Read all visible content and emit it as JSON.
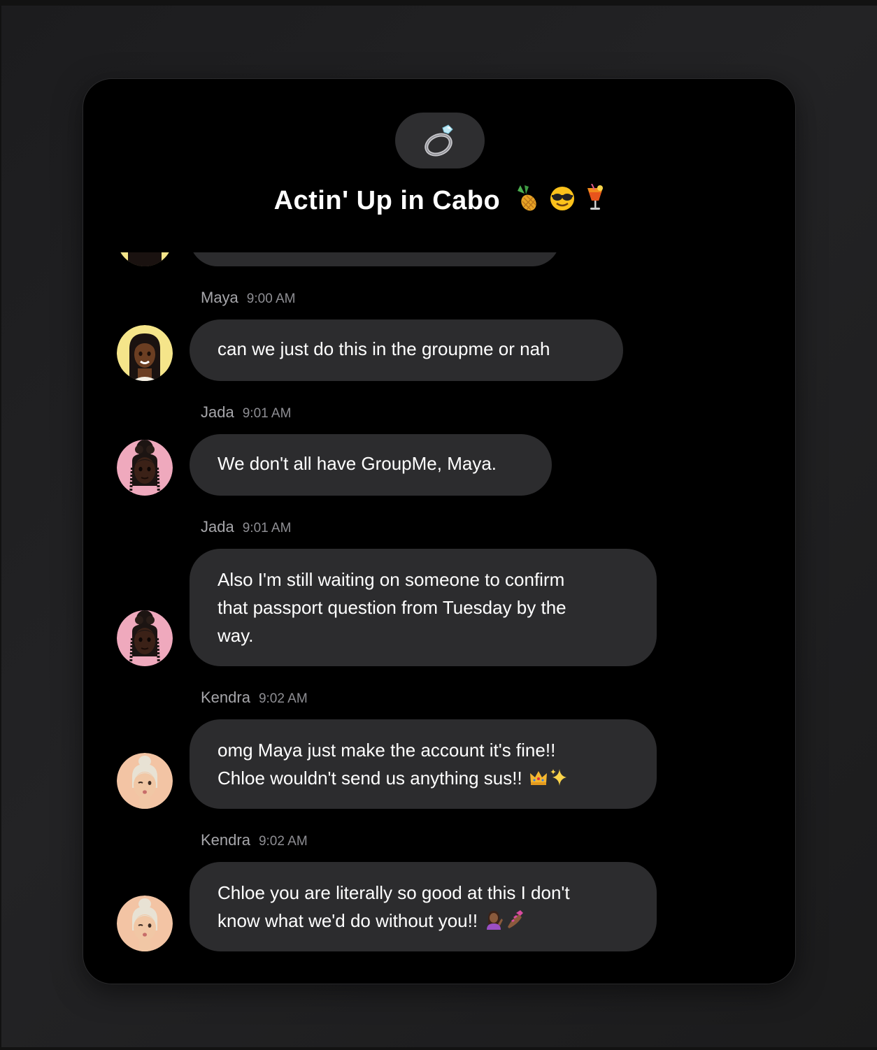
{
  "chat": {
    "title": "Actin' Up in Cabo",
    "title_emoji": [
      "pineapple-icon",
      "sunglasses-face-icon",
      "tropical-drink-icon"
    ],
    "group_icon": "diamond-ring-icon"
  },
  "messages": [
    {
      "sender": "Maya",
      "time": "9:00 AM",
      "text": "can we just do this in the groupme or nah",
      "avatar_color": "#f5e58a"
    },
    {
      "sender": "Jada",
      "time": "9:01 AM",
      "text": "We don't all have GroupMe, Maya.",
      "avatar_color": "#efa9bd"
    },
    {
      "sender": "Jada",
      "time": "9:01 AM",
      "text_lines": [
        "Also I'm still waiting on someone to confirm",
        "that passport question from Tuesday by the",
        "way."
      ],
      "avatar_color": "#efa9bd"
    },
    {
      "sender": "Kendra",
      "time": "9:02 AM",
      "text_lines": [
        "omg Maya just make the account it's fine!!",
        "Chloe wouldn't send us anything sus!!"
      ],
      "trailing_emoji": [
        "crown-icon",
        "sparkles-icon"
      ],
      "avatar_color": "#f3c4a4"
    },
    {
      "sender": "Kendra",
      "time": "9:02 AM",
      "text_lines": [
        "Chloe you are literally so good at this I don't",
        "know what we'd do without you!!"
      ],
      "trailing_emoji": [
        "woman-tipping-hand-icon",
        "nail-polish-icon"
      ],
      "avatar_color": "#f3c4a4"
    }
  ]
}
